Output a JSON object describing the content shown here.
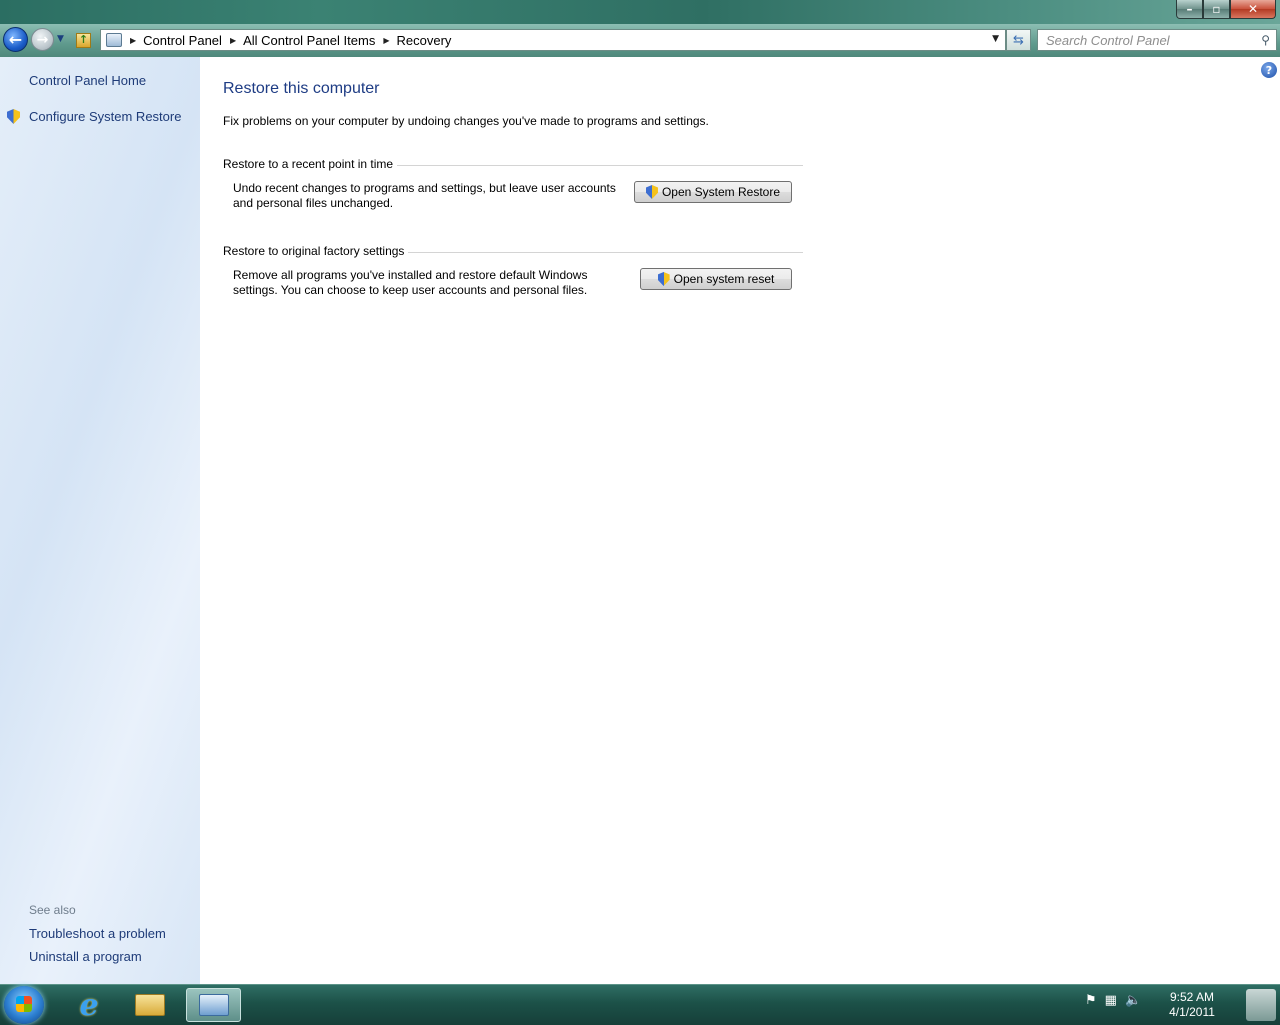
{
  "window": {
    "caption": {
      "minimize": "–",
      "maximize": "▫",
      "close": "✕"
    }
  },
  "navbar": {
    "breadcrumbs": [
      "Control Panel",
      "All Control Panel Items",
      "Recovery"
    ],
    "search_placeholder": "Search Control Panel"
  },
  "sidebar": {
    "home_link": "Control Panel Home",
    "configure_link": "Configure System Restore",
    "see_also_heading": "See also",
    "see_also_links": [
      "Troubleshoot a problem",
      "Uninstall a program"
    ]
  },
  "main": {
    "title": "Restore this computer",
    "intro": "Fix problems on your computer by undoing changes you've made to programs and settings.",
    "groups": [
      {
        "heading": "Restore to a recent point in time",
        "description": "Undo recent changes to programs and settings, but leave user accounts and personal files unchanged.",
        "button": "Open System Restore"
      },
      {
        "heading": "Restore to original factory settings",
        "description": "Remove all programs you've installed and restore default Windows settings. You can choose to keep user accounts and personal files.",
        "button": "Open system reset"
      }
    ]
  },
  "taskbar": {
    "clock_time": "9:52 AM",
    "clock_date": "4/1/2011"
  },
  "colors": {
    "link": "#1e3b78",
    "title": "#1e3c84",
    "sidebar": "#dfeaf7",
    "taskbar": "#1c5148"
  }
}
